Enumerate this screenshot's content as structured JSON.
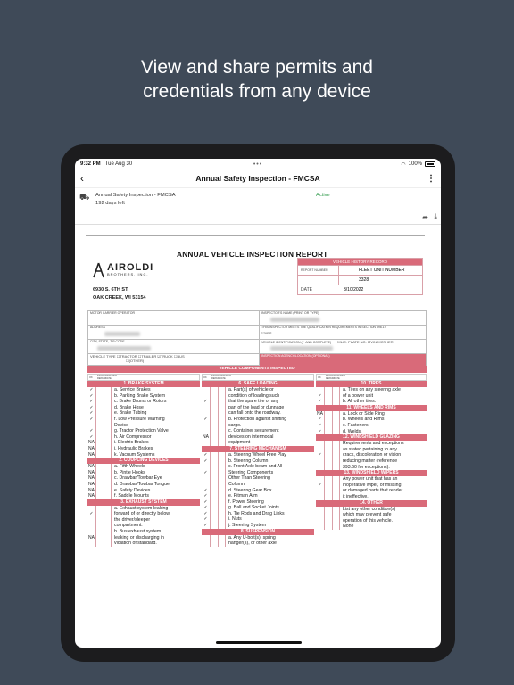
{
  "headline": [
    "View and share permits and",
    "credentials from any device"
  ],
  "status_bar": {
    "time": "9:32 PM",
    "date": "Tue Aug 30",
    "battery": "100%"
  },
  "nav": {
    "title": "Annual Safety Inspection - FMCSA",
    "back_icon": "chevron-left-icon",
    "more_icon": "more-vertical-icon"
  },
  "doc": {
    "name": "Annual Safety Inspection - FMCSA",
    "days_left": "192 days left",
    "status": "Active"
  },
  "form": {
    "title": "ANNUAL VEHICLE INSPECTION REPORT",
    "company": {
      "logo_text": "AIROLDI",
      "logo_sub": "BROTHERS, INC.",
      "address1": "6930 S. 6TH ST.",
      "address2": "OAK CREEK, WI 53154"
    },
    "history": {
      "header": "VEHICLE HISTORY RECORD",
      "report_label": "REPORT NUMBER",
      "fleet_label": "FLEET UNIT NUMBER",
      "fleet_value": "3328",
      "date_label": "DATE",
      "date_value": "3/10/2022"
    },
    "fields": {
      "motor_carrier": "MOTOR CARRIER OPERATOR",
      "address": "ADDRESS",
      "city": "CITY, STATE, ZIP CODE",
      "vehicle_type": "VEHICLE TYPE",
      "types": [
        "TRACTOR",
        "TRAILER",
        "TRUCK",
        "BUS",
        "(OTHER)"
      ],
      "inspector": "INSPECTOR'S NAME (PRINT OR TYPE)",
      "qualification": "THIS INSPECTOR MEETS THE QUALIFICATION REQUIREMENTS IN SECTION 396.19",
      "yes": "YES",
      "vehicle_id": "VEHICLE IDENTIFICATION (✓ AND COMPLETE)",
      "id_types": [
        "LIC. PLATE NO.",
        "VIN",
        "OTHER"
      ],
      "agency": "INSPECTION AGENCY/LOCATION (OPTIONAL)"
    },
    "components_header": "VEHICLE COMPONENTS INSPECTED",
    "col_headers": [
      "OK",
      "NEEDS REPAIR",
      "REPAIRED DATE"
    ],
    "columns": [
      {
        "sections": [
          {
            "title": "1. BRAKE SYSTEM",
            "items": [
              [
                "✓",
                "a. Service Brakes"
              ],
              [
                "✓",
                "b. Parking Brake System"
              ],
              [
                "✓",
                "c. Brake Drums or Rotors"
              ],
              [
                "✓",
                "d. Brake Hose"
              ],
              [
                "✓",
                "e. Brake Tubing"
              ],
              [
                "✓",
                "f. Low Pressure Warning"
              ],
              [
                "",
                "   Device"
              ],
              [
                "✓",
                "g. Tractor Protection Valve"
              ],
              [
                "✓",
                "h. Air Compressor"
              ],
              [
                "NA",
                "i. Electric Brakes"
              ],
              [
                "NA",
                "j. Hydraulic Brakes"
              ],
              [
                "NA",
                "k. Vacuum Systems"
              ]
            ]
          },
          {
            "title": "2. COUPLING DEVICES",
            "items": [
              [
                "NA",
                "a. Fifth Wheels"
              ],
              [
                "NA",
                "b. Pintle Hooks"
              ],
              [
                "NA",
                "c. Drawbar/Towbar Eye"
              ],
              [
                "NA",
                "d. Drawbar/Towbar Tongue"
              ],
              [
                "NA",
                "e. Safety Devices"
              ],
              [
                "NA",
                "f. Saddle Mounts"
              ]
            ]
          },
          {
            "title": "3. EXHAUST SYSTEM",
            "items": [
              [
                "",
                "a. Exhaust system leaking"
              ],
              [
                "✓",
                "   forward of or directly below"
              ],
              [
                "",
                "   the driver/sleeper"
              ],
              [
                "",
                "   compartment."
              ],
              [
                "",
                "b. Bus exhaust system"
              ],
              [
                "NA",
                "   leaking or discharging in"
              ],
              [
                "",
                "   violation of standard."
              ]
            ]
          }
        ]
      },
      {
        "sections": [
          {
            "title": "6. SAFE LOADING",
            "items": [
              [
                "",
                "a. Part(s) of vehicle or"
              ],
              [
                "",
                "   condition of loading such"
              ],
              [
                "✓",
                "   that the spare tire or any"
              ],
              [
                "",
                "   part of the load or dunnage"
              ],
              [
                "",
                "   can fall onto the roadway."
              ],
              [
                "✓",
                "b. Protection against shifting"
              ],
              [
                "",
                "   cargo."
              ],
              [
                "",
                "c. Container securement"
              ],
              [
                "NA",
                "   devices on intermodal"
              ],
              [
                "",
                "   equipment"
              ]
            ]
          },
          {
            "title": "7. STEERING MECHANISM",
            "items": [
              [
                "✓",
                "a. Steering Wheel Free Play"
              ],
              [
                "✓",
                "b. Steering Column"
              ],
              [
                "",
                "c. Front Axle beam and All"
              ],
              [
                "✓",
                "   Steering Components"
              ],
              [
                "",
                "   Other Than Steering"
              ],
              [
                "",
                "   Column"
              ],
              [
                "✓",
                "d. Steering Gear Box"
              ],
              [
                "✓",
                "e. Pitman Arm"
              ],
              [
                "✓",
                "f. Power Steering"
              ],
              [
                "✓",
                "g. Ball and Socket Joints"
              ],
              [
                "✓",
                "h. Tie Rods and Drag Links"
              ],
              [
                "✓",
                "i. Nuts"
              ],
              [
                "✓",
                "j. Steering System"
              ]
            ]
          },
          {
            "title": "8. SUSPENSION",
            "items": [
              [
                "",
                "a. Any U-bolt(s), spring"
              ],
              [
                "",
                "   hanger(s), or other axle"
              ]
            ]
          }
        ]
      },
      {
        "sections": [
          {
            "title": "10. TIRES",
            "items": [
              [
                "",
                "a. Tires on any steering axle"
              ],
              [
                "✓",
                "   of a power unit"
              ],
              [
                "✓",
                "b. All other tires."
              ]
            ]
          },
          {
            "title": "11. WHEELS AND RIMS",
            "items": [
              [
                "NA",
                "a. Lock or Side Ring"
              ],
              [
                "✓",
                "b. Wheels and Rims"
              ],
              [
                "✓",
                "c. Fasteners"
              ],
              [
                "✓",
                "d. Welds."
              ]
            ]
          },
          {
            "title": "12. WINDSHIELD GLAZING",
            "items": [
              [
                "",
                "Requirements and exceptions"
              ],
              [
                "",
                "as stated pertaining to any"
              ],
              [
                "✓",
                "crack, discoloration or vision"
              ],
              [
                "",
                "reducing matter (reference"
              ],
              [
                "",
                "393.60 for exceptions)."
              ]
            ]
          },
          {
            "title": "13. WINDSHIELD WIPERS",
            "items": [
              [
                "",
                "Any power unit that has an"
              ],
              [
                "✓",
                "inoperative wiper, or missing"
              ],
              [
                "",
                "or damaged parts that render"
              ],
              [
                "",
                "it ineffective."
              ]
            ]
          },
          {
            "title": "14. OTHER",
            "items": [
              [
                "",
                "List any other condition(s)"
              ],
              [
                "",
                "which may prevent safe"
              ],
              [
                "",
                "operation of this vehicle."
              ],
              [
                "",
                ""
              ],
              [
                "",
                "None"
              ]
            ]
          }
        ]
      }
    ]
  }
}
